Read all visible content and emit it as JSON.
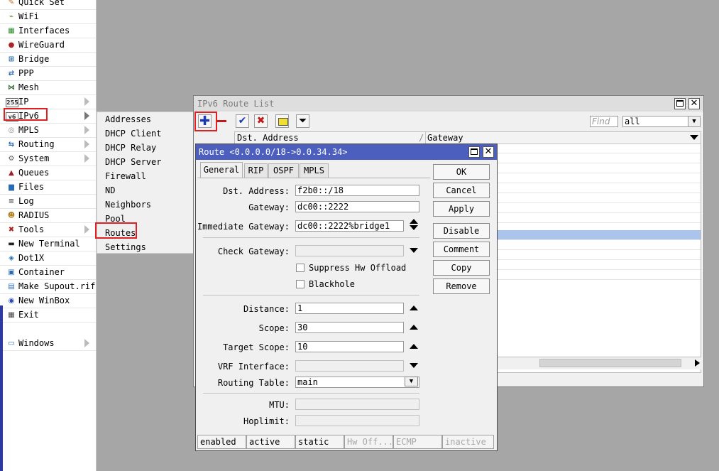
{
  "left_menu": {
    "items": [
      {
        "label": "Quick Set",
        "icon": "magic-wand-icon",
        "glyph": "✎",
        "color": "#c07020",
        "submenu": false
      },
      {
        "label": "WiFi",
        "icon": "wifi-icon",
        "glyph": "⌁",
        "color": "#4a8a2a",
        "submenu": false
      },
      {
        "label": "Interfaces",
        "icon": "interfaces-icon",
        "glyph": "▦",
        "color": "#2a8a2a",
        "submenu": false
      },
      {
        "label": "WireGuard",
        "icon": "wireguard-icon",
        "glyph": "●",
        "color": "#b02020",
        "submenu": false
      },
      {
        "label": "Bridge",
        "icon": "bridge-icon",
        "glyph": "⊞",
        "color": "#2a6ab0",
        "submenu": false
      },
      {
        "label": "PPP",
        "icon": "ppp-icon",
        "glyph": "⇄",
        "color": "#2a6ab0",
        "submenu": false
      },
      {
        "label": "Mesh",
        "icon": "mesh-icon",
        "glyph": "⋈",
        "color": "#3a6a3a",
        "submenu": false
      },
      {
        "label": "IP",
        "icon": "ip-icon",
        "glyph": "255",
        "color": "#333333",
        "submenu": true
      },
      {
        "label": "IPv6",
        "icon": "ipv6-icon",
        "glyph": "v6",
        "color": "#333333",
        "submenu": true
      },
      {
        "label": "MPLS",
        "icon": "mpls-icon",
        "glyph": "◎",
        "color": "#888888",
        "submenu": true
      },
      {
        "label": "Routing",
        "icon": "routing-icon",
        "glyph": "⇆",
        "color": "#2a6ab0",
        "submenu": true
      },
      {
        "label": "System",
        "icon": "gear-icon",
        "glyph": "⚙",
        "color": "#606060",
        "submenu": true
      },
      {
        "label": "Queues",
        "icon": "queues-icon",
        "glyph": "▲",
        "color": "#a02020",
        "submenu": false
      },
      {
        "label": "Files",
        "icon": "folder-icon",
        "glyph": "▆",
        "color": "#2a6ab0",
        "submenu": false
      },
      {
        "label": "Log",
        "icon": "log-icon",
        "glyph": "≡",
        "color": "#606060",
        "submenu": false
      },
      {
        "label": "RADIUS",
        "icon": "radius-icon",
        "glyph": "☻",
        "color": "#b08020",
        "submenu": false
      },
      {
        "label": "Tools",
        "icon": "tools-icon",
        "glyph": "✖",
        "color": "#b02020",
        "submenu": true
      },
      {
        "label": "New Terminal",
        "icon": "terminal-icon",
        "glyph": "▬",
        "color": "#222222",
        "submenu": false
      },
      {
        "label": "Dot1X",
        "icon": "dot1x-icon",
        "glyph": "◈",
        "color": "#2a6ab0",
        "submenu": false
      },
      {
        "label": "Container",
        "icon": "container-icon",
        "glyph": "▣",
        "color": "#2a6ab0",
        "submenu": false
      },
      {
        "label": "Make Supout.rif",
        "icon": "supout-icon",
        "glyph": "▤",
        "color": "#2a6ab0",
        "submenu": false
      },
      {
        "label": "New WinBox",
        "icon": "winbox-icon",
        "glyph": "◉",
        "color": "#2a4ab0",
        "submenu": false
      },
      {
        "label": "Exit",
        "icon": "exit-icon",
        "glyph": "▦",
        "color": "#444444",
        "submenu": false
      }
    ],
    "windows": {
      "label": "Windows",
      "icon": "windows-icon",
      "glyph": "▭",
      "color": "#2a6ab0"
    }
  },
  "ipv6_submenu": {
    "items": [
      "Addresses",
      "DHCP Client",
      "DHCP Relay",
      "DHCP Server",
      "Firewall",
      "ND",
      "Neighbors",
      "Pool",
      "Routes",
      "Settings"
    ]
  },
  "route_list": {
    "title": "IPv6 Route List",
    "find_placeholder": "Find",
    "filter_value": "all",
    "columns": [
      "Dst. Address",
      "Gateway"
    ],
    "toolbar": [
      "add-icon",
      "remove-icon",
      "enable-icon",
      "disable-icon",
      "comment-icon",
      "filter-icon"
    ],
    "colors": {
      "add": "#1a3ab0",
      "remove": "#c01a1a",
      "enable": "#1a3ab0",
      "disable": "#c01a1a",
      "comment": "#f2e030"
    }
  },
  "route_dialog": {
    "title": "Route <0.0.0.0/18->0.0.34.34>",
    "tabs": [
      "General",
      "RIP",
      "OSPF",
      "MPLS"
    ],
    "fields": {
      "dst_address": {
        "label": "Dst. Address:",
        "value": "f2b0::/18"
      },
      "gateway": {
        "label": "Gateway:",
        "value": "dc00::2222"
      },
      "immediate_gateway": {
        "label": "Immediate Gateway:",
        "value": "dc00::2222%bridge1"
      },
      "check_gateway": {
        "label": "Check Gateway:",
        "value": ""
      },
      "distance": {
        "label": "Distance:",
        "value": "1"
      },
      "scope": {
        "label": "Scope:",
        "value": "30"
      },
      "target_scope": {
        "label": "Target Scope:",
        "value": "10"
      },
      "vrf_interface": {
        "label": "VRF Interface:",
        "value": ""
      },
      "routing_table": {
        "label": "Routing Table:",
        "value": "main"
      },
      "mtu": {
        "label": "MTU:",
        "value": ""
      },
      "hoplimit": {
        "label": "Hoplimit:",
        "value": ""
      }
    },
    "checkboxes": {
      "suppress_hw_offload": "Suppress Hw Offload",
      "blackhole": "Blackhole"
    },
    "buttons": [
      "OK",
      "Cancel",
      "Apply",
      "Disable",
      "Comment",
      "Copy",
      "Remove"
    ],
    "status": [
      "enabled",
      "active",
      "static",
      "Hw Off...",
      "ECMP",
      "inactive"
    ]
  }
}
